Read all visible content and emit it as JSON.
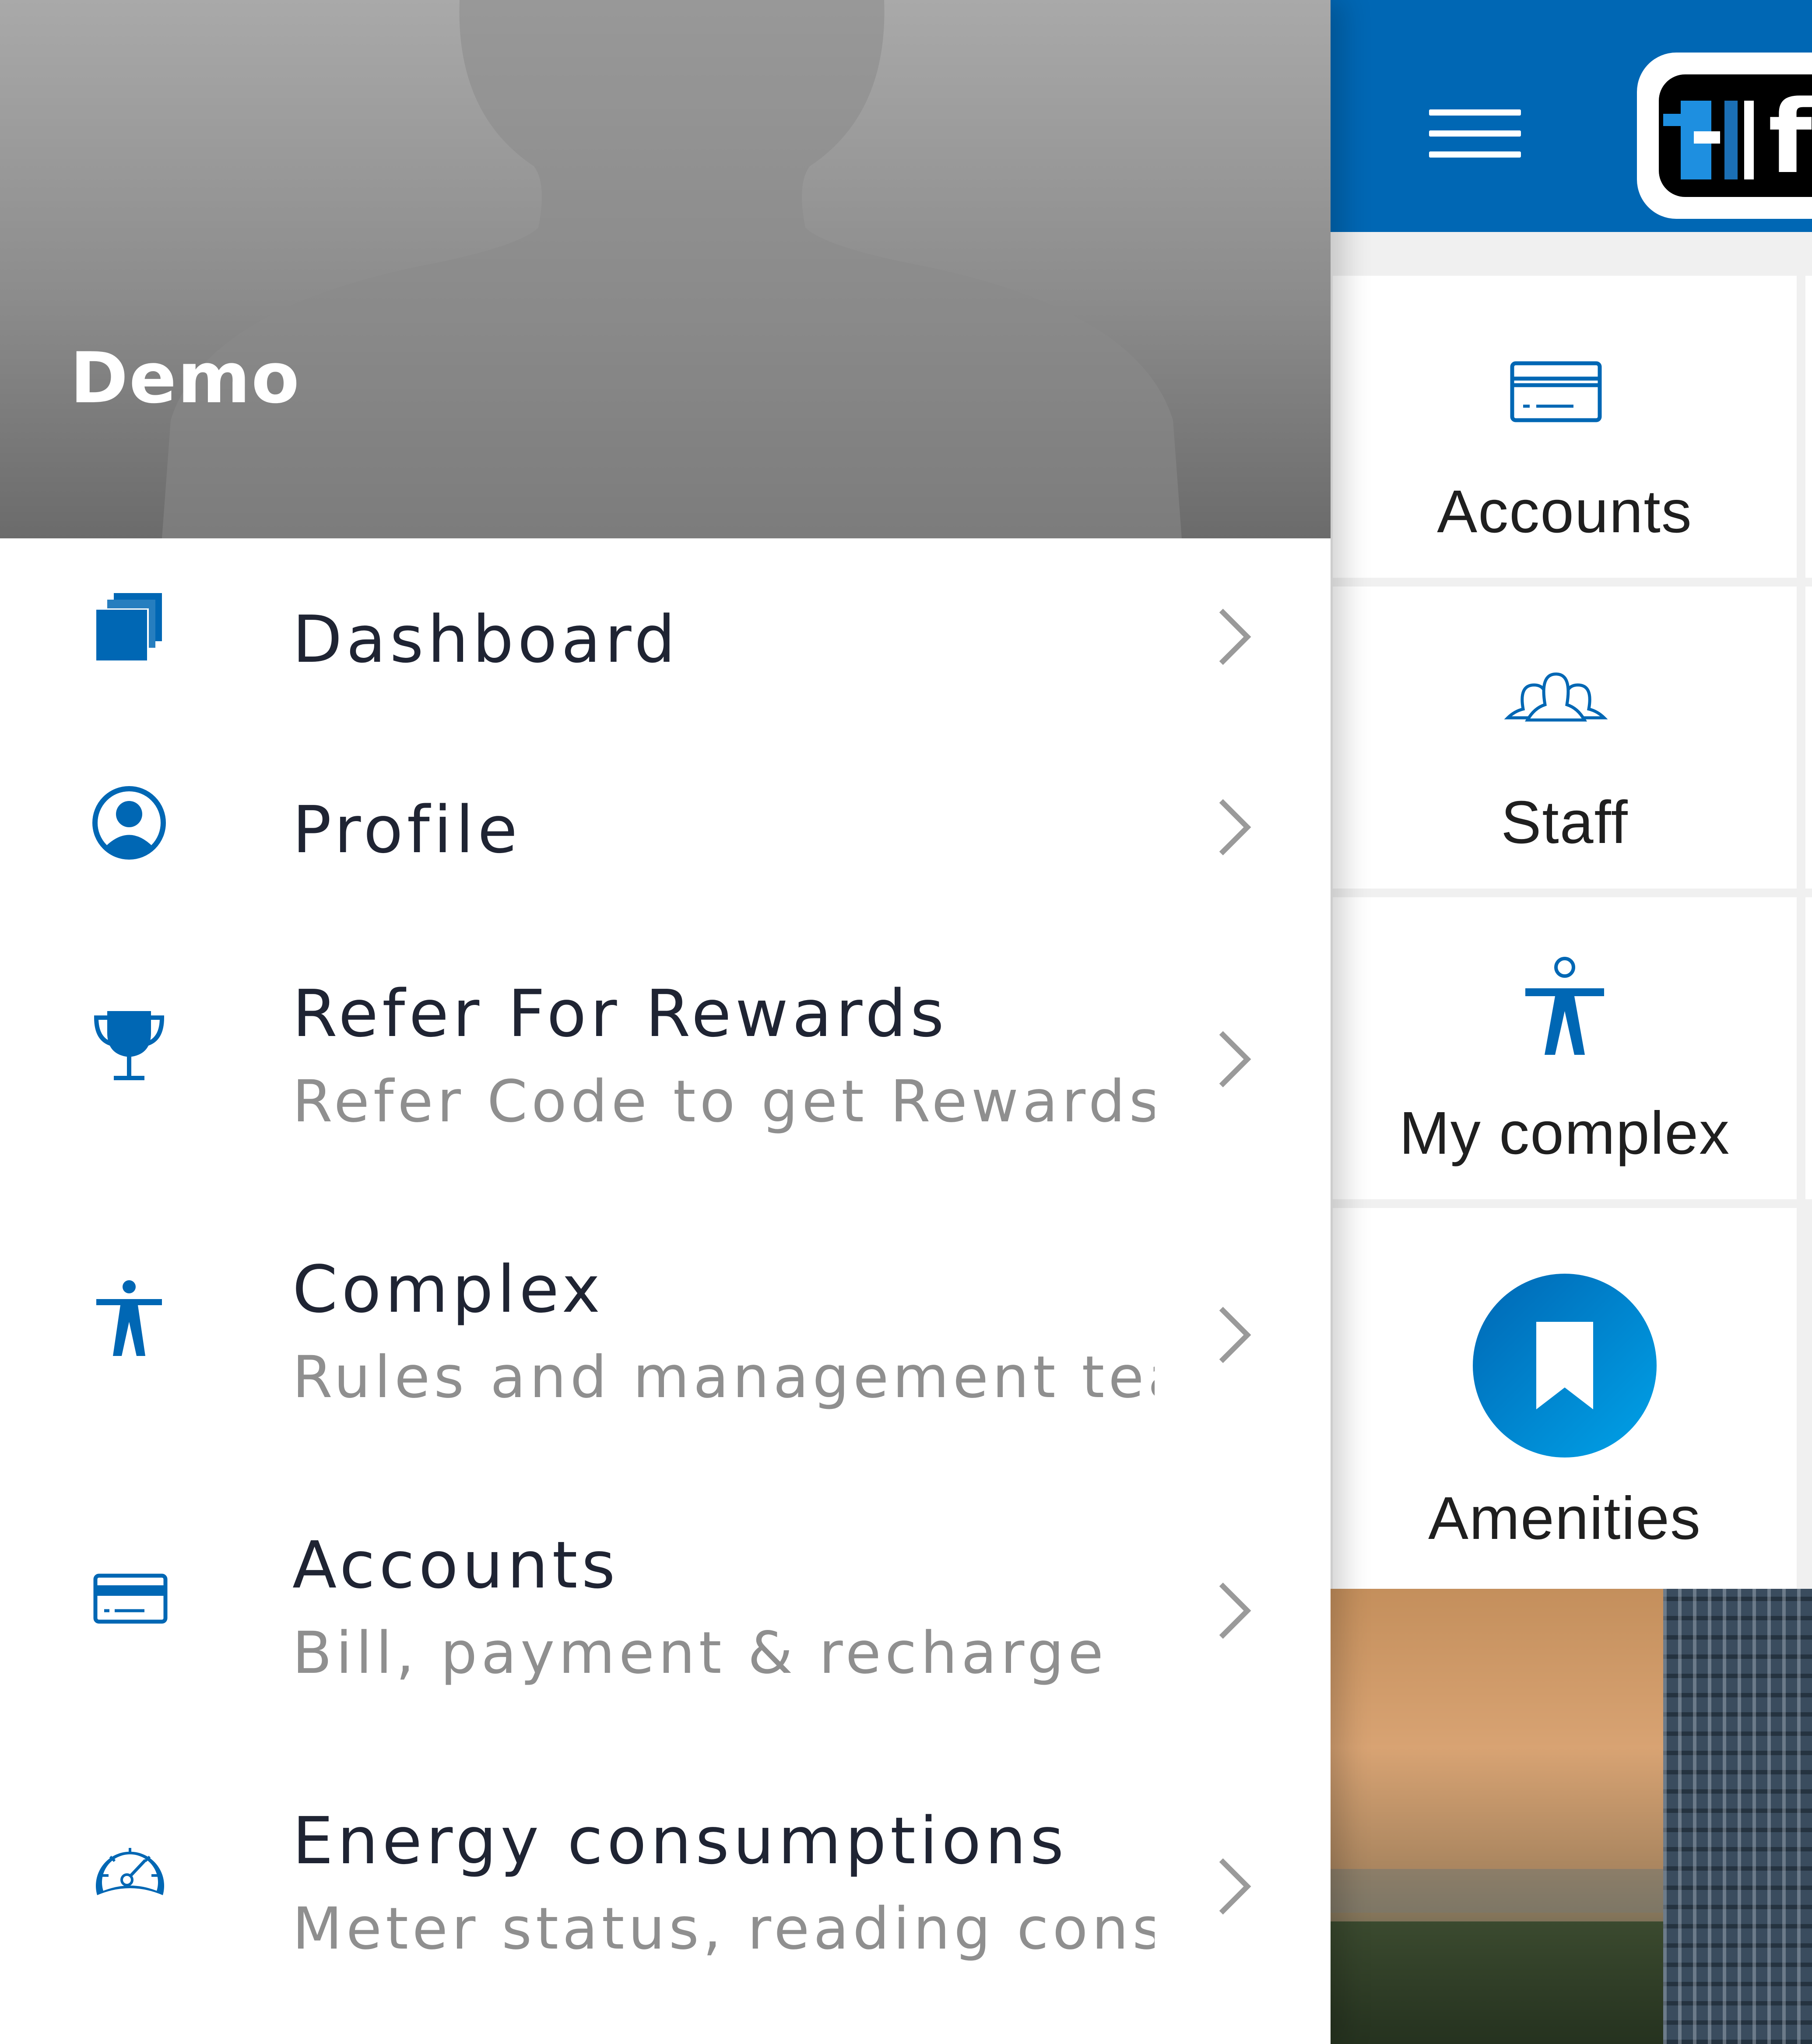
{
  "app": {
    "tiles": [
      {
        "label": "Accounts",
        "icon": "credit-card-icon"
      },
      {
        "label": "Staff",
        "icon": "people-group-icon"
      },
      {
        "label": "My complex",
        "icon": "accessibility-person-icon"
      },
      {
        "label": "Amenities",
        "icon": "bookmark-circle-icon"
      }
    ]
  },
  "drawer": {
    "user_name": "Demo",
    "menu": [
      {
        "title": "Dashboard",
        "subtitle": "",
        "icon": "stacked-squares-icon"
      },
      {
        "title": "Profile",
        "subtitle": "",
        "icon": "user-circle-icon"
      },
      {
        "title": "Refer For Rewards",
        "subtitle": "Refer Code to get Rewards",
        "icon": "trophy-icon"
      },
      {
        "title": "Complex",
        "subtitle": "Rules and management team",
        "icon": "accessibility-person-icon"
      },
      {
        "title": "Accounts",
        "subtitle": "Bill, payment & recharge",
        "icon": "credit-card-icon"
      },
      {
        "title": "Energy consumptions",
        "subtitle": "Meter status, reading consumption",
        "icon": "speedometer-icon"
      }
    ]
  },
  "colors": {
    "primary": "#0067b4",
    "accent_light": "#009be0",
    "title_text": "#1f2433",
    "subtitle_text": "#8f8f8f"
  }
}
